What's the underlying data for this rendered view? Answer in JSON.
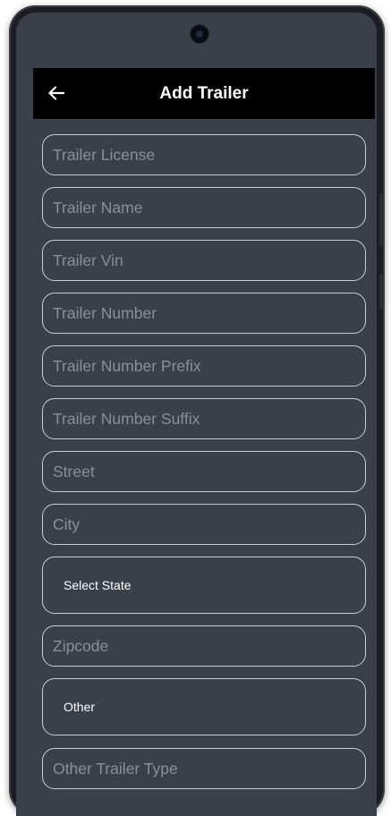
{
  "appbar": {
    "title": "Add Trailer",
    "back_icon": "arrow-left-icon"
  },
  "form": {
    "trailer_license": {
      "placeholder": "Trailer License"
    },
    "trailer_name": {
      "placeholder": "Trailer Name"
    },
    "trailer_vin": {
      "placeholder": "Trailer Vin"
    },
    "trailer_number": {
      "placeholder": "Trailer Number"
    },
    "trailer_number_prefix": {
      "placeholder": "Trailer Number Prefix"
    },
    "trailer_number_suffix": {
      "placeholder": "Trailer Number Suffix"
    },
    "street": {
      "placeholder": "Street"
    },
    "city": {
      "placeholder": "City"
    },
    "state": {
      "value": "Select State"
    },
    "zipcode": {
      "placeholder": "Zipcode"
    },
    "trailer_type": {
      "value": "Other"
    },
    "other_trailer_type": {
      "placeholder": "Other Trailer Type"
    }
  },
  "colors": {
    "screen_bg": "#3a3f4a",
    "appbar_bg": "#000000",
    "field_border": "#c9ccd2",
    "placeholder": "#8b8f99",
    "text": "#ffffff"
  }
}
